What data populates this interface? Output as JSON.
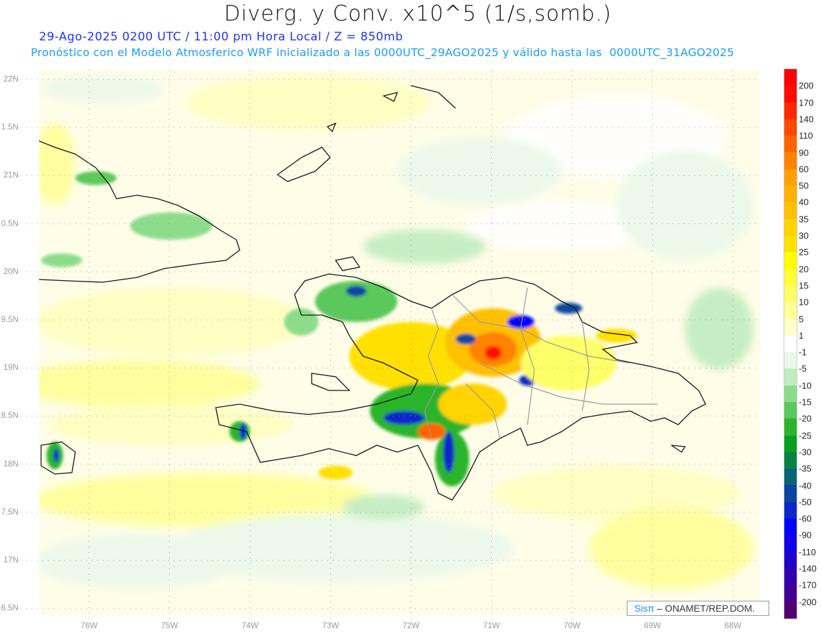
{
  "header": {
    "title": "Diverg. y Conv. x10^5 (1/s,somb.)",
    "subtitle_1": "29-Ago-2025  0200 UTC / 11:00 pm Hora Local / Z = 850mb",
    "subtitle_2": "Pronóstico con el Modelo Atmosferico WRF inicializado a las 0000UTC_29AGO2025 y válido hasta las  0000UTC_31AGO2025"
  },
  "map": {
    "lat_labels": [
      "22N",
      "1.5N",
      "21N",
      "0.5N",
      "20N",
      "9.5N",
      "19N",
      "8.5N",
      "18N",
      "7.5N",
      "17N",
      "6.5N"
    ],
    "lon_labels": [
      "76W",
      "75W",
      "74W",
      "73W",
      "72W",
      "71W",
      "70W",
      "69W",
      "68W"
    ]
  },
  "credit": {
    "brand": "Sisπ",
    "text": "– ONAMET/REP.DOM."
  },
  "colorbar": {
    "labels": [
      "200",
      "170",
      "140",
      "110",
      "90",
      "60",
      "50",
      "40",
      "35",
      "30",
      "25",
      "20",
      "15",
      "10",
      "5",
      "1",
      "-1",
      "-5",
      "-10",
      "-15",
      "-20",
      "-25",
      "-30",
      "-35",
      "-40",
      "-50",
      "-60",
      "-90",
      "-110",
      "-140",
      "-170",
      "-200"
    ],
    "colors": [
      "#ff0000",
      "#ff0c00",
      "#ff2a00",
      "#ff4800",
      "#ff6400",
      "#ff8200",
      "#ffa000",
      "#ffb000",
      "#ffc000",
      "#ffd400",
      "#ffe000",
      "#ffff00",
      "#ffff38",
      "#ffff68",
      "#ffff98",
      "#ffffc8",
      "#ffffff",
      "#eaf8ea",
      "#c0ecc0",
      "#8cdc8c",
      "#5ac85a",
      "#2cb42c",
      "#08a020",
      "#0a8246",
      "#0a6478",
      "#0846a0",
      "#0a28c8",
      "#0000ff",
      "#1400e8",
      "#2200cc",
      "#3300b0",
      "#420090",
      "#520070"
    ]
  }
}
